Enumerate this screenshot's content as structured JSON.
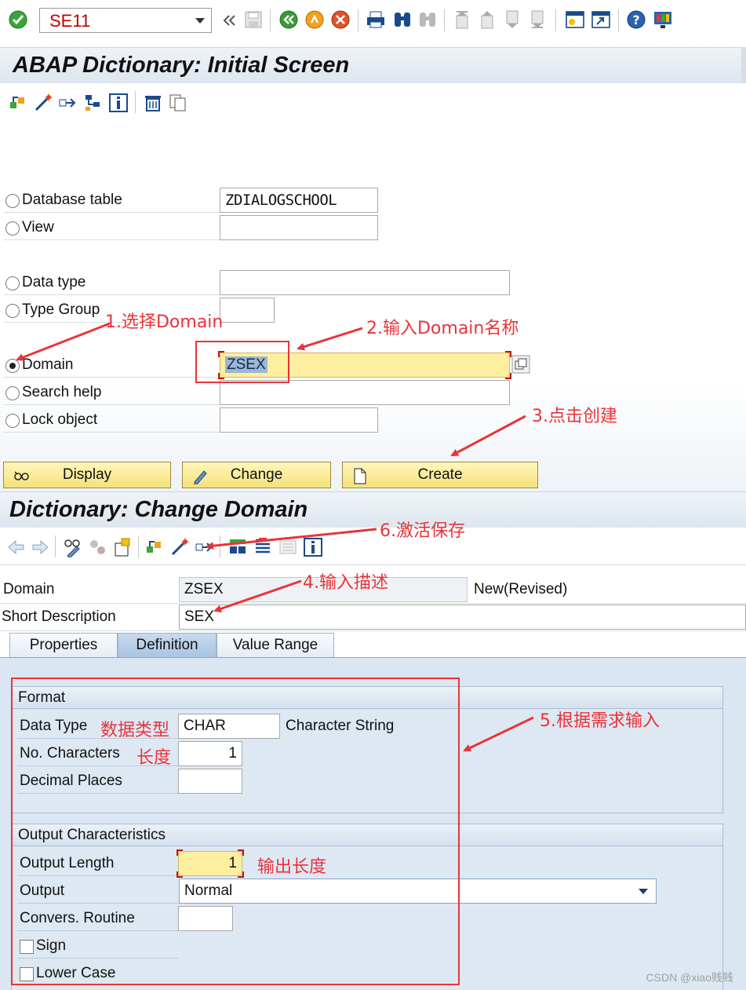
{
  "command_bar": {
    "transaction_code": "SE11"
  },
  "screen1": {
    "title": "ABAP Dictionary: Initial Screen",
    "objects": [
      {
        "label": "Database table",
        "value": "ZDIALOGSCHOOL",
        "selected": false
      },
      {
        "label": "View",
        "value": "",
        "selected": false
      },
      {
        "label": "Data type",
        "value": "",
        "selected": false
      },
      {
        "label": "Type Group",
        "value": "",
        "selected": false
      },
      {
        "label": "Domain",
        "value": "ZSEX",
        "selected": true
      },
      {
        "label": "Search help",
        "value": "",
        "selected": false
      },
      {
        "label": "Lock object",
        "value": "",
        "selected": false
      }
    ],
    "buttons": {
      "display": "Display",
      "change": "Change",
      "create": "Create"
    }
  },
  "screen2": {
    "title": "Dictionary: Change Domain",
    "domain_label": "Domain",
    "domain_value": "ZSEX",
    "domain_status": "New(Revised)",
    "short_desc_label": "Short Description",
    "short_desc_value": "SEX",
    "tabs": [
      {
        "label": "Properties",
        "active": false
      },
      {
        "label": "Definition",
        "active": true
      },
      {
        "label": "Value Range",
        "active": false
      }
    ],
    "format": {
      "header": "Format",
      "data_type_label": "Data Type",
      "data_type_value": "CHAR",
      "data_type_desc": "Character String",
      "no_chars_label": "No. Characters",
      "no_chars_value": "1",
      "decimal_label": "Decimal Places",
      "decimal_value": ""
    },
    "output": {
      "header": "Output Characteristics",
      "length_label": "Output Length",
      "length_value": "1",
      "output_label": "Output",
      "output_value": "Normal",
      "conv_label": "Convers. Routine",
      "conv_value": "",
      "sign_label": "Sign",
      "lower_label": "Lower Case"
    }
  },
  "annotations": {
    "a1": "1.选择Domain",
    "a2": "2.输入Domain名称",
    "a3": "3.点击创建",
    "a4": "4.输入描述",
    "a5": "5.根据需求输入",
    "a6": "6.激活保存",
    "data_type": "数据类型",
    "length": "长度",
    "output_length": "输出长度"
  },
  "watermark": "CSDN @xiao贱贱",
  "colors": {
    "annotation": "#e8343a",
    "title_bg": "#dde6ee",
    "panel_bg": "#dae6f2",
    "button_bg": "#f5e27a"
  },
  "icons": [
    "enter-icon",
    "save-icon",
    "back-icon",
    "exit-icon",
    "cancel-icon",
    "print-icon",
    "find-icon",
    "find-next-icon",
    "first-page-icon",
    "prev-page-icon",
    "next-page-icon",
    "last-page-icon",
    "new-session-icon",
    "shortcut-icon",
    "help-icon",
    "customize-layout-icon"
  ]
}
